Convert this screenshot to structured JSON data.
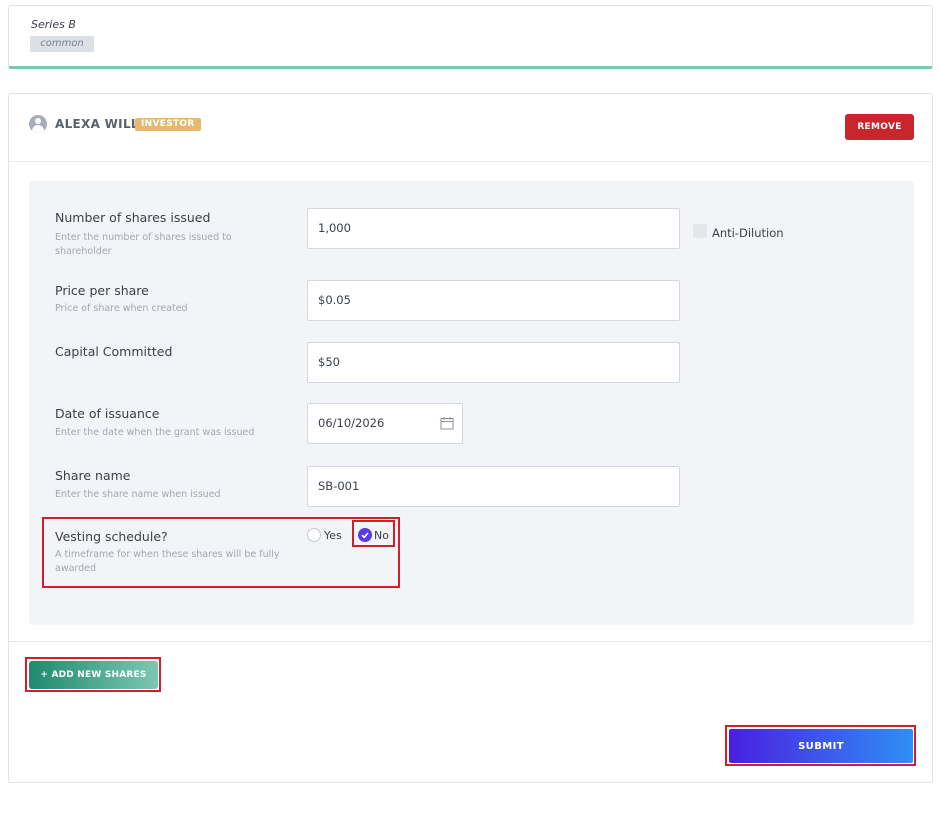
{
  "series": {
    "name": "Series B",
    "type": "common"
  },
  "holder": {
    "name": "ALEXA WILL",
    "role": "INVESTOR",
    "remove_label": "REMOVE"
  },
  "form": {
    "shares_issued": {
      "label": "Number of shares issued",
      "help": "Enter the number of shares issued to shareholder",
      "value": "1,000"
    },
    "anti_dilution": {
      "label": "Anti-Dilution",
      "checked": false
    },
    "price_per_share": {
      "label": "Price per share",
      "help": "Price of share when created",
      "value": "$0.05"
    },
    "capital_committed": {
      "label": "Capital Committed",
      "value": "$50"
    },
    "date_of_issuance": {
      "label": "Date of issuance",
      "help": "Enter the date when the grant was issued",
      "value": "06/10/2026"
    },
    "share_name": {
      "label": "Share name",
      "help": "Enter the share name when issued",
      "value": "SB-001"
    },
    "vesting": {
      "label": "Vesting schedule?",
      "help": "A timeframe for when these shares will be fully awarded",
      "yes_label": "Yes",
      "no_label": "No",
      "selected": "No"
    }
  },
  "actions": {
    "add_shares_label": "+ ADD NEW SHARES",
    "submit_label": "SUBMIT"
  },
  "colors": {
    "accent_teal": "#1e8a6e",
    "remove_red": "#c8262d",
    "submit_start": "#4a1fe0",
    "submit_end": "#2f8ff5",
    "badge_orange": "#e8b86d",
    "radio_purple": "#5b3be0"
  }
}
